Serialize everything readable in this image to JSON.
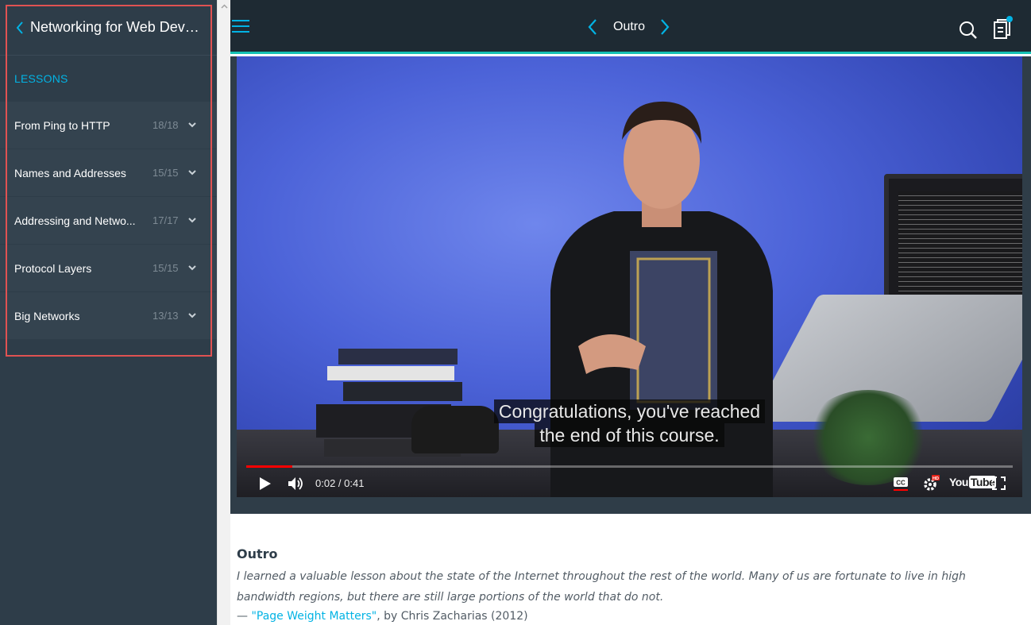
{
  "sidebar": {
    "course_title": "Networking for Web Devel...",
    "lessons_label": "LESSONS",
    "items": [
      {
        "label": "From Ping to HTTP",
        "count": "18/18"
      },
      {
        "label": "Names and Addresses",
        "count": "15/15"
      },
      {
        "label": "Addressing and Netwo...",
        "count": "17/17"
      },
      {
        "label": "Protocol Layers",
        "count": "15/15"
      },
      {
        "label": "Big Networks",
        "count": "13/13"
      }
    ]
  },
  "topbar": {
    "title": "Outro",
    "accent": "#15c1b4",
    "notification_color": "#02b3e4"
  },
  "video": {
    "caption_line1": "Congratulations, you've reached",
    "caption_line2": "the end of this course.",
    "time": "0:02 / 0:41",
    "progress": 0.06,
    "logo_you": "You",
    "logo_tube": "Tube"
  },
  "content": {
    "title": "Outro",
    "quote": "I learned a valuable lesson about the state of the Internet throughout the rest of the world. Many of us are fortunate to live in high bandwidth regions, but there are still large portions of the world that do not.",
    "cite_dash": "— ",
    "cite_link": "\"Page Weight Matters\"",
    "cite_rest": ", by Chris Zacharias (2012)"
  },
  "icons": [
    "chevron-left-icon",
    "chevron-down-icon",
    "hamburger-icon",
    "search-icon",
    "notes-icon",
    "play-icon",
    "volume-icon",
    "cc-icon",
    "settings-icon",
    "fullscreen-icon"
  ]
}
